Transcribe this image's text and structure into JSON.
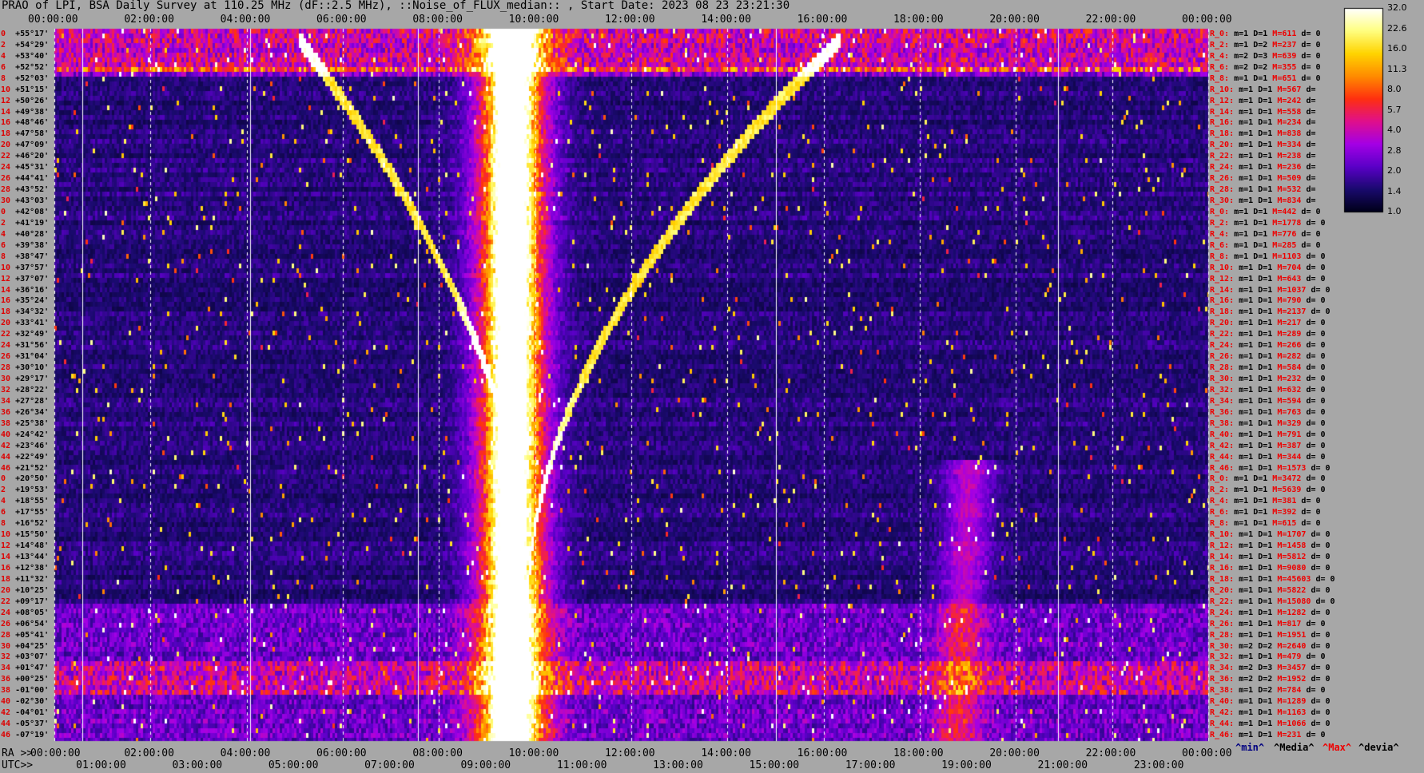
{
  "title": "PRAO of LPI, BSA Daily Survey at 110.25 MHz (dF::2.5 MHz), ::Noise_of_FLUX_median:: , Start Date: 2023 08 23 23:21:30",
  "chart_data": {
    "type": "heatmap",
    "x_top_ticks": [
      "00:00:00",
      "02:00:00",
      "04:00:00",
      "06:00:00",
      "08:00:00",
      "10:00:00",
      "12:00:00",
      "14:00:00",
      "16:00:00",
      "18:00:00",
      "20:00:00",
      "22:00:00",
      "00:00:00"
    ],
    "ra_axis": {
      "label": "RA >>",
      "ticks": [
        "00:00:00",
        "02:00:00",
        "04:00:00",
        "06:00:00",
        "08:00:00",
        "10:00:00",
        "12:00:00",
        "14:00:00",
        "16:00:00",
        "18:00:00",
        "20:00:00",
        "22:00:00",
        "00:00:00"
      ]
    },
    "utc_axis": {
      "label": "UTC>>",
      "ticks": [
        "01:00:00",
        "03:00:00",
        "05:00:00",
        "07:00:00",
        "09:00:00",
        "11:00:00",
        "13:00:00",
        "15:00:00",
        "17:00:00",
        "19:00:00",
        "21:00:00",
        "23:00:00"
      ]
    },
    "declinations": [
      "+55°17'",
      "+54°29'",
      "+53°40'",
      "+52°52'",
      "+52°03'",
      "+51°15'",
      "+50°26'",
      "+49°38'",
      "+48°46'",
      "+47°58'",
      "+47°09'",
      "+46°20'",
      "+45°31'",
      "+44°41'",
      "+43°52'",
      "+43°03'",
      "+42°08'",
      "+41°19'",
      "+40°28'",
      "+39°38'",
      "+38°47'",
      "+37°57'",
      "+37°07'",
      "+36°16'",
      "+35°24'",
      "+34°32'",
      "+33°41'",
      "+32°49'",
      "+31°56'",
      "+31°04'",
      "+30°10'",
      "+29°17'",
      "+28°22'",
      "+27°28'",
      "+26°34'",
      "+25°38'",
      "+24°42'",
      "+23°46'",
      "+22°49'",
      "+21°52'",
      "+20°50'",
      "+19°53'",
      "+18°55'",
      "+17°55'",
      "+16°52'",
      "+15°50'",
      "+14°48'",
      "+13°44'",
      "+12°38'",
      "+11°32'",
      "+10°25'",
      "+09°17'",
      "+08°05'",
      "+06°54'",
      "+05°41'",
      "+04°25'",
      "+03°07'",
      "+01°47'",
      "+00°25'",
      "-01°00'",
      "-02°30'",
      "-04°01'",
      "-05°37'",
      "-07°19'"
    ],
    "row_index": [
      0,
      2,
      4,
      6,
      8,
      10,
      12,
      14,
      16,
      18,
      20,
      22,
      24,
      26,
      28,
      30,
      0,
      2,
      4,
      6,
      8,
      10,
      12,
      14,
      16,
      18,
      20,
      22,
      24,
      26,
      28,
      30,
      32,
      34,
      36,
      38,
      40,
      42,
      44,
      46,
      0,
      2,
      4,
      6,
      8,
      10,
      12,
      14,
      16,
      18,
      20,
      22,
      24,
      26,
      28,
      30,
      32,
      34,
      36,
      38,
      40,
      42,
      44,
      46
    ],
    "row_stats": [
      {
        "r": "R_0:",
        "min": "m=1",
        "med": "D=1",
        "max": "M=611",
        "dev": "d= 0"
      },
      {
        "r": "R_2:",
        "min": "m=1",
        "med": "D=2",
        "max": "M=237",
        "dev": "d= 0"
      },
      {
        "r": "R_4:",
        "min": "m=2",
        "med": "D=3",
        "max": "M=639",
        "dev": "d= 0"
      },
      {
        "r": "R_6:",
        "min": "m=2",
        "med": "D=2",
        "max": "M=355",
        "dev": "d= 0"
      },
      {
        "r": "R_8:",
        "min": "m=1",
        "med": "D=1",
        "max": "M=651",
        "dev": "d= 0"
      },
      {
        "r": "R_10:",
        "min": "m=1",
        "med": "D=1",
        "max": "M=567",
        "dev": "d="
      },
      {
        "r": "R_12:",
        "min": "m=1",
        "med": "D=1",
        "max": "M=242",
        "dev": "d="
      },
      {
        "r": "R_14:",
        "min": "m=1",
        "med": "D=1",
        "max": "M=558",
        "dev": "d="
      },
      {
        "r": "R_16:",
        "min": "m=1",
        "med": "D=1",
        "max": "M=234",
        "dev": "d="
      },
      {
        "r": "R_18:",
        "min": "m=1",
        "med": "D=1",
        "max": "M=838",
        "dev": "d="
      },
      {
        "r": "R_20:",
        "min": "m=1",
        "med": "D=1",
        "max": "M=334",
        "dev": "d="
      },
      {
        "r": "R_22:",
        "min": "m=1",
        "med": "D=1",
        "max": "M=238",
        "dev": "d="
      },
      {
        "r": "R_24:",
        "min": "m=1",
        "med": "D=1",
        "max": "M=236",
        "dev": "d="
      },
      {
        "r": "R_26:",
        "min": "m=1",
        "med": "D=1",
        "max": "M=509",
        "dev": "d="
      },
      {
        "r": "R_28:",
        "min": "m=1",
        "med": "D=1",
        "max": "M=532",
        "dev": "d="
      },
      {
        "r": "R_30:",
        "min": "m=1",
        "med": "D=1",
        "max": "M=834",
        "dev": "d="
      },
      {
        "r": "R_0:",
        "min": "m=1",
        "med": "D=1",
        "max": "M=442",
        "dev": "d= 0"
      },
      {
        "r": "R_2:",
        "min": "m=1",
        "med": "D=1",
        "max": "M=1778",
        "dev": "d= 0"
      },
      {
        "r": "R_4:",
        "min": "m=1",
        "med": "D=1",
        "max": "M=776",
        "dev": "d= 0"
      },
      {
        "r": "R_6:",
        "min": "m=1",
        "med": "D=1",
        "max": "M=285",
        "dev": "d= 0"
      },
      {
        "r": "R_8:",
        "min": "m=1",
        "med": "D=1",
        "max": "M=1103",
        "dev": "d= 0"
      },
      {
        "r": "R_10:",
        "min": "m=1",
        "med": "D=1",
        "max": "M=704",
        "dev": "d= 0"
      },
      {
        "r": "R_12:",
        "min": "m=1",
        "med": "D=1",
        "max": "M=643",
        "dev": "d= 0"
      },
      {
        "r": "R_14:",
        "min": "m=1",
        "med": "D=1",
        "max": "M=1037",
        "dev": "d= 0"
      },
      {
        "r": "R_16:",
        "min": "m=1",
        "med": "D=1",
        "max": "M=790",
        "dev": "d= 0"
      },
      {
        "r": "R_18:",
        "min": "m=1",
        "med": "D=1",
        "max": "M=2137",
        "dev": "d= 0"
      },
      {
        "r": "R_20:",
        "min": "m=1",
        "med": "D=1",
        "max": "M=217",
        "dev": "d= 0"
      },
      {
        "r": "R_22:",
        "min": "m=1",
        "med": "D=1",
        "max": "M=289",
        "dev": "d= 0"
      },
      {
        "r": "R_24:",
        "min": "m=1",
        "med": "D=1",
        "max": "M=266",
        "dev": "d= 0"
      },
      {
        "r": "R_26:",
        "min": "m=1",
        "med": "D=1",
        "max": "M=282",
        "dev": "d= 0"
      },
      {
        "r": "R_28:",
        "min": "m=1",
        "med": "D=1",
        "max": "M=584",
        "dev": "d= 0"
      },
      {
        "r": "R_30:",
        "min": "m=1",
        "med": "D=1",
        "max": "M=232",
        "dev": "d= 0"
      },
      {
        "r": "R_32:",
        "min": "m=1",
        "med": "D=1",
        "max": "M=632",
        "dev": "d= 0"
      },
      {
        "r": "R_34:",
        "min": "m=1",
        "med": "D=1",
        "max": "M=594",
        "dev": "d= 0"
      },
      {
        "r": "R_36:",
        "min": "m=1",
        "med": "D=1",
        "max": "M=763",
        "dev": "d= 0"
      },
      {
        "r": "R_38:",
        "min": "m=1",
        "med": "D=1",
        "max": "M=329",
        "dev": "d= 0"
      },
      {
        "r": "R_40:",
        "min": "m=1",
        "med": "D=1",
        "max": "M=791",
        "dev": "d= 0"
      },
      {
        "r": "R_42:",
        "min": "m=1",
        "med": "D=1",
        "max": "M=387",
        "dev": "d= 0"
      },
      {
        "r": "R_44:",
        "min": "m=1",
        "med": "D=1",
        "max": "M=344",
        "dev": "d= 0"
      },
      {
        "r": "R_46:",
        "min": "m=1",
        "med": "D=1",
        "max": "M=1573",
        "dev": "d= 0"
      },
      {
        "r": "R_0:",
        "min": "m=1",
        "med": "D=1",
        "max": "M=3472",
        "dev": "d= 0"
      },
      {
        "r": "R_2:",
        "min": "m=1",
        "med": "D=1",
        "max": "M=5639",
        "dev": "d= 0"
      },
      {
        "r": "R_4:",
        "min": "m=1",
        "med": "D=1",
        "max": "M=381",
        "dev": "d= 0"
      },
      {
        "r": "R_6:",
        "min": "m=1",
        "med": "D=1",
        "max": "M=392",
        "dev": "d= 0"
      },
      {
        "r": "R_8:",
        "min": "m=1",
        "med": "D=1",
        "max": "M=615",
        "dev": "d= 0"
      },
      {
        "r": "R_10:",
        "min": "m=1",
        "med": "D=1",
        "max": "M=1707",
        "dev": "d= 0"
      },
      {
        "r": "R_12:",
        "min": "m=1",
        "med": "D=1",
        "max": "M=1458",
        "dev": "d= 0"
      },
      {
        "r": "R_14:",
        "min": "m=1",
        "med": "D=1",
        "max": "M=5812",
        "dev": "d= 0"
      },
      {
        "r": "R_16:",
        "min": "m=1",
        "med": "D=1",
        "max": "M=9080",
        "dev": "d= 0"
      },
      {
        "r": "R_18:",
        "min": "m=1",
        "med": "D=1",
        "max": "M=45603",
        "dev": "d= 0"
      },
      {
        "r": "R_20:",
        "min": "m=1",
        "med": "D=1",
        "max": "M=5822",
        "dev": "d= 0"
      },
      {
        "r": "R_22:",
        "min": "m=1",
        "med": "D=1",
        "max": "M=15080",
        "dev": "d= 0"
      },
      {
        "r": "R_24:",
        "min": "m=1",
        "med": "D=1",
        "max": "M=1282",
        "dev": "d= 0"
      },
      {
        "r": "R_26:",
        "min": "m=1",
        "med": "D=1",
        "max": "M=817",
        "dev": "d= 0"
      },
      {
        "r": "R_28:",
        "min": "m=1",
        "med": "D=1",
        "max": "M=1951",
        "dev": "d= 0"
      },
      {
        "r": "R_30:",
        "min": "m=2",
        "med": "D=2",
        "max": "M=2640",
        "dev": "d= 0"
      },
      {
        "r": "R_32:",
        "min": "m=1",
        "med": "D=1",
        "max": "M=479",
        "dev": "d= 0"
      },
      {
        "r": "R_34:",
        "min": "m=2",
        "med": "D=3",
        "max": "M=3457",
        "dev": "d= 0"
      },
      {
        "r": "R_36:",
        "min": "m=2",
        "med": "D=2",
        "max": "M=1952",
        "dev": "d= 0"
      },
      {
        "r": "R_38:",
        "min": "m=1",
        "med": "D=2",
        "max": "M=784",
        "dev": "d= 0"
      },
      {
        "r": "R_40:",
        "min": "m=1",
        "med": "D=1",
        "max": "M=1289",
        "dev": "d= 0"
      },
      {
        "r": "R_42:",
        "min": "m=1",
        "med": "D=1",
        "max": "M=1163",
        "dev": "d= 0"
      },
      {
        "r": "R_44:",
        "min": "m=1",
        "med": "D=1",
        "max": "M=1066",
        "dev": "d= 0"
      },
      {
        "r": "R_46:",
        "min": "m=1",
        "med": "D=1",
        "max": "M=231",
        "dev": "d= 0"
      }
    ],
    "colorbar": {
      "ticks": [
        "32.0",
        "22.6",
        "16.0",
        "11.3",
        "8.0",
        "5.7",
        "4.0",
        "2.8",
        "2.0",
        "1.4",
        "1.0"
      ],
      "colors": [
        "#000018",
        "#1a0a6e",
        "#5b00c8",
        "#a400e6",
        "#e0108c",
        "#ff3010",
        "#ff8c00",
        "#ffd400",
        "#ffff80",
        "#ffffff"
      ]
    },
    "legend": {
      "min": "^min^",
      "median": "^Media^",
      "max": "^Max^",
      "devia": "^devia^"
    }
  }
}
